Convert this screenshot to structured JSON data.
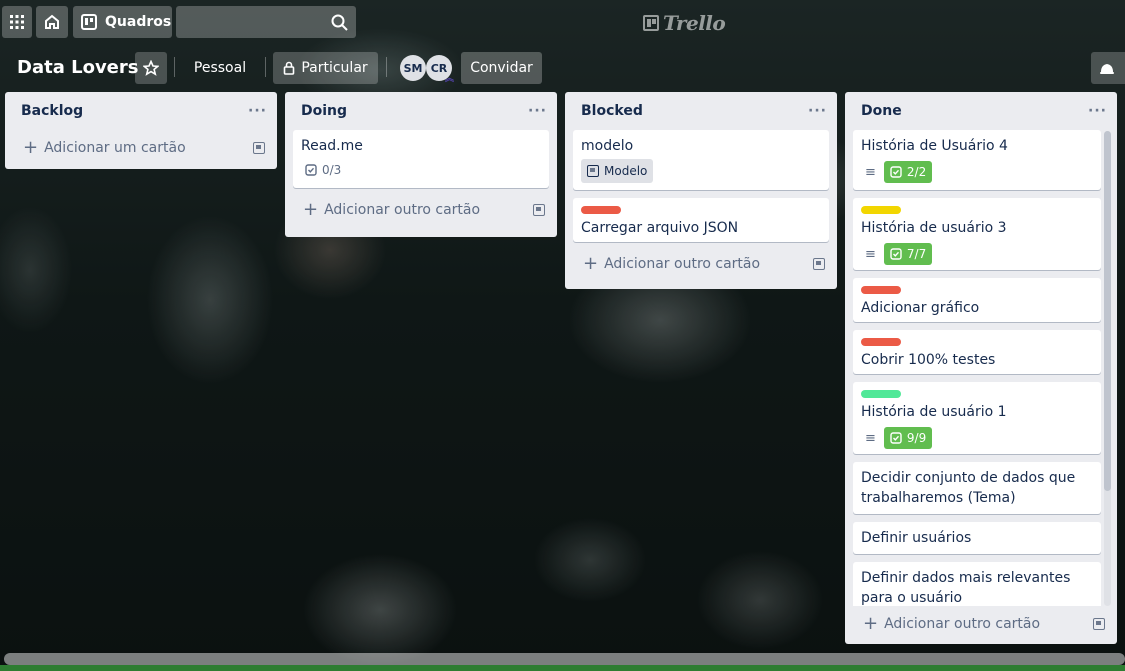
{
  "topbar": {
    "apps_icon": "apps-grid-icon",
    "home_icon": "home-icon",
    "boards_label": "Quadros",
    "search_icon": "search-icon",
    "logo_text": "Trello"
  },
  "board": {
    "title": "Data Lovers",
    "star_icon": "star-icon",
    "team_label": "Pessoal",
    "visibility_label": "Particular",
    "members": [
      "SM",
      "CR"
    ],
    "invite_label": "Convidar"
  },
  "lists": [
    {
      "title": "Backlog",
      "add_label": "Adicionar um cartão",
      "cards": []
    },
    {
      "title": "Doing",
      "add_label": "Adicionar outro cartão",
      "cards": [
        {
          "title": "Read.me",
          "checklist": "0/3",
          "checklist_complete": false
        }
      ]
    },
    {
      "title": "Blocked",
      "add_label": "Adicionar outro cartão",
      "cards": [
        {
          "title": "modelo",
          "template_badge": "Modelo"
        },
        {
          "title": "Carregar arquivo JSON",
          "label_color": "#eb5a46"
        }
      ]
    },
    {
      "title": "Done",
      "add_label": "Adicionar outro cartão",
      "cards": [
        {
          "title": "História de Usuário 4",
          "has_description": true,
          "checklist": "2/2",
          "checklist_complete": true
        },
        {
          "title": "História de usuário 3",
          "label_color": "#f2d600",
          "has_description": true,
          "checklist": "7/7",
          "checklist_complete": true
        },
        {
          "title": "Adicionar gráfico",
          "label_color": "#eb5a46"
        },
        {
          "title": "Cobrir 100% testes",
          "label_color": "#eb5a46"
        },
        {
          "title": "História de usuário 1",
          "label_color": "#51e898",
          "has_description": true,
          "checklist": "9/9",
          "checklist_complete": true
        },
        {
          "title": "Decidir conjunto de dados que trabalharemos (Tema)"
        },
        {
          "title": "Definir usuários"
        },
        {
          "title": "Definir dados mais relevantes para o usuário"
        }
      ]
    }
  ]
}
